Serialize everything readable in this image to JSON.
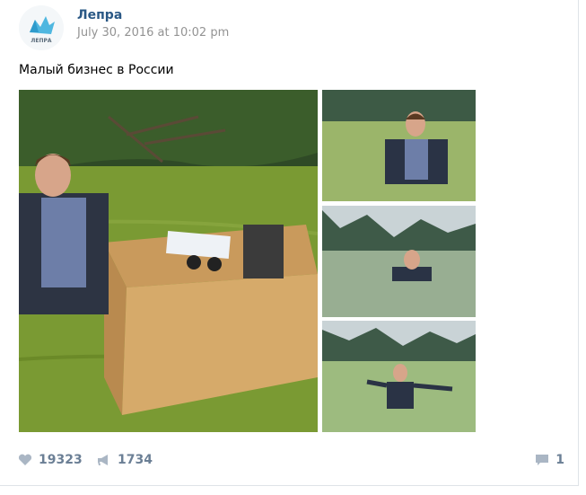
{
  "post": {
    "author": "Лепра",
    "date": "July 30, 2016 at 10:02 pm",
    "avatar_logo_text": "ЛЕПРА",
    "text": "Малый бизнес в России"
  },
  "photos": [
    {
      "name": "boy at desk in swamp"
    },
    {
      "name": "boy standing in swamp"
    },
    {
      "name": "boy submerged in swamp"
    },
    {
      "name": "boy arms outstretched in swamp"
    }
  ],
  "actions": {
    "likes": "19323",
    "reposts": "1734",
    "comments": "1"
  },
  "colors": {
    "link": "#2a5885",
    "muted": "#939393",
    "action": "#6b7f95",
    "swamp": "#6f8f2c",
    "sky": "#c9d3d6"
  }
}
